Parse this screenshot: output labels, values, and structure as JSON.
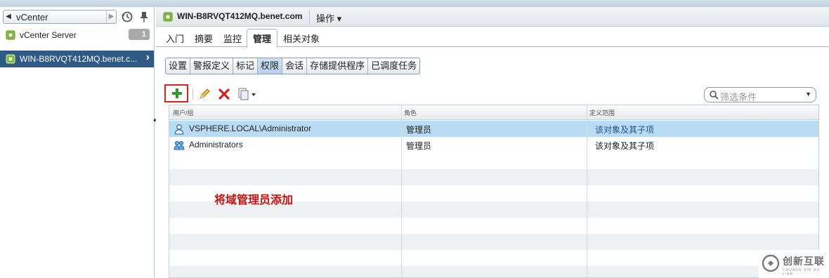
{
  "navigator": {
    "title": "vCenter",
    "items": [
      {
        "label": "vCenter Server",
        "badge": "1"
      },
      {
        "label": "WIN-B8RVQT412MQ.benet.c...",
        "selected": true
      }
    ]
  },
  "header": {
    "object_title": "WIN-B8RVQT412MQ.benet.com",
    "actions_label": "操作 ▾"
  },
  "tabs": [
    "入门",
    "摘要",
    "监控",
    "管理",
    "相关对象"
  ],
  "active_tab": "管理",
  "subtabs": [
    "设置",
    "警报定义",
    "标记",
    "权限",
    "会话",
    "存储提供程序",
    "已调度任务"
  ],
  "active_subtab": "权限",
  "toolbar": {
    "add": "add-permission",
    "edit": "edit",
    "delete": "delete",
    "export": "export"
  },
  "filter": {
    "placeholder": "筛选条件"
  },
  "grid": {
    "columns": [
      "用户/组",
      "角色",
      "定义范围"
    ],
    "rows": [
      {
        "user": "VSPHERE.LOCAL\\Administrator",
        "role": "管理员",
        "scope": "该对象及其子项",
        "icon": "user-icon",
        "selected": true
      },
      {
        "user": "Administrators",
        "role": "管理员",
        "scope": "该对象及其子项",
        "icon": "group-icon"
      }
    ]
  },
  "annotation": "将域管理员添加",
  "watermark": {
    "text": "创新互联",
    "sub": "CHUANG XIN HU LIAN"
  },
  "colors": {
    "selected_tree": "#2f5a86",
    "selected_row": "#b9dcf5",
    "annotation": "#cc1010",
    "add_highlight": "#e02020"
  }
}
